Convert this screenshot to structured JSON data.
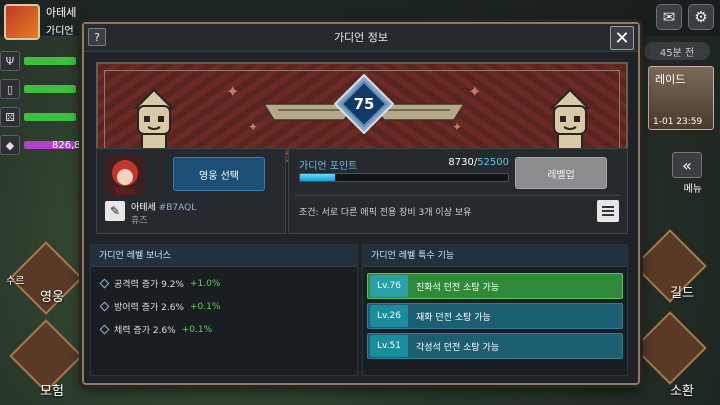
{
  "hud": {
    "player_name": "아테세",
    "player_sub": "가디언",
    "side_value": "826,8",
    "timer": "45분 전",
    "raid_label": "레이드",
    "raid_time": "1-01 23:59",
    "menu_label": "메뉴",
    "menu_hero": "영웅",
    "menu_adventure": "모험",
    "menu_guild": "길드",
    "menu_summon": "소환",
    "menu_left_extra": "수르"
  },
  "modal": {
    "title": "가디언 정보",
    "help_label": "?",
    "close_label": "✕"
  },
  "guardian": {
    "level": "75"
  },
  "hero": {
    "select_label": "영웅 선택",
    "name": "아테세",
    "code": "#B7AQL",
    "title": "휴즈"
  },
  "points": {
    "label": "가디언 포인트",
    "current": "8730",
    "max": "52500",
    "progress_fraction": 0.166,
    "levelup_label": "레벨업",
    "condition": "조건: 서로 다른 에픽 전용 장비 3개 이상 보유"
  },
  "bonus": {
    "header": "가디언 레벨 보너스",
    "rows": [
      {
        "label": "공격력 증가 9.2%",
        "add": "+1.0%"
      },
      {
        "label": "방어력 증가 2.6%",
        "add": "+0.1%"
      },
      {
        "label": "체력 증가 2.6%",
        "add": "+0.1%"
      }
    ]
  },
  "special": {
    "header": "가디언 레벨 특수 기능",
    "rows": [
      {
        "level": "Lv.76",
        "text": "진화석 던전 소탕 가능",
        "active": true
      },
      {
        "level": "Lv.26",
        "text": "재화 던전 소탕 가능",
        "active": false
      },
      {
        "level": "Lv.51",
        "text": "각성석 던전 소탕 가능",
        "active": false
      }
    ]
  },
  "colors": {
    "accent": "#5ec7e8",
    "bonus_add": "#5bd65b",
    "active_skill": "#2f8a3a",
    "inactive_skill": "#1d5f72",
    "hero_select": "#1d4f76"
  }
}
